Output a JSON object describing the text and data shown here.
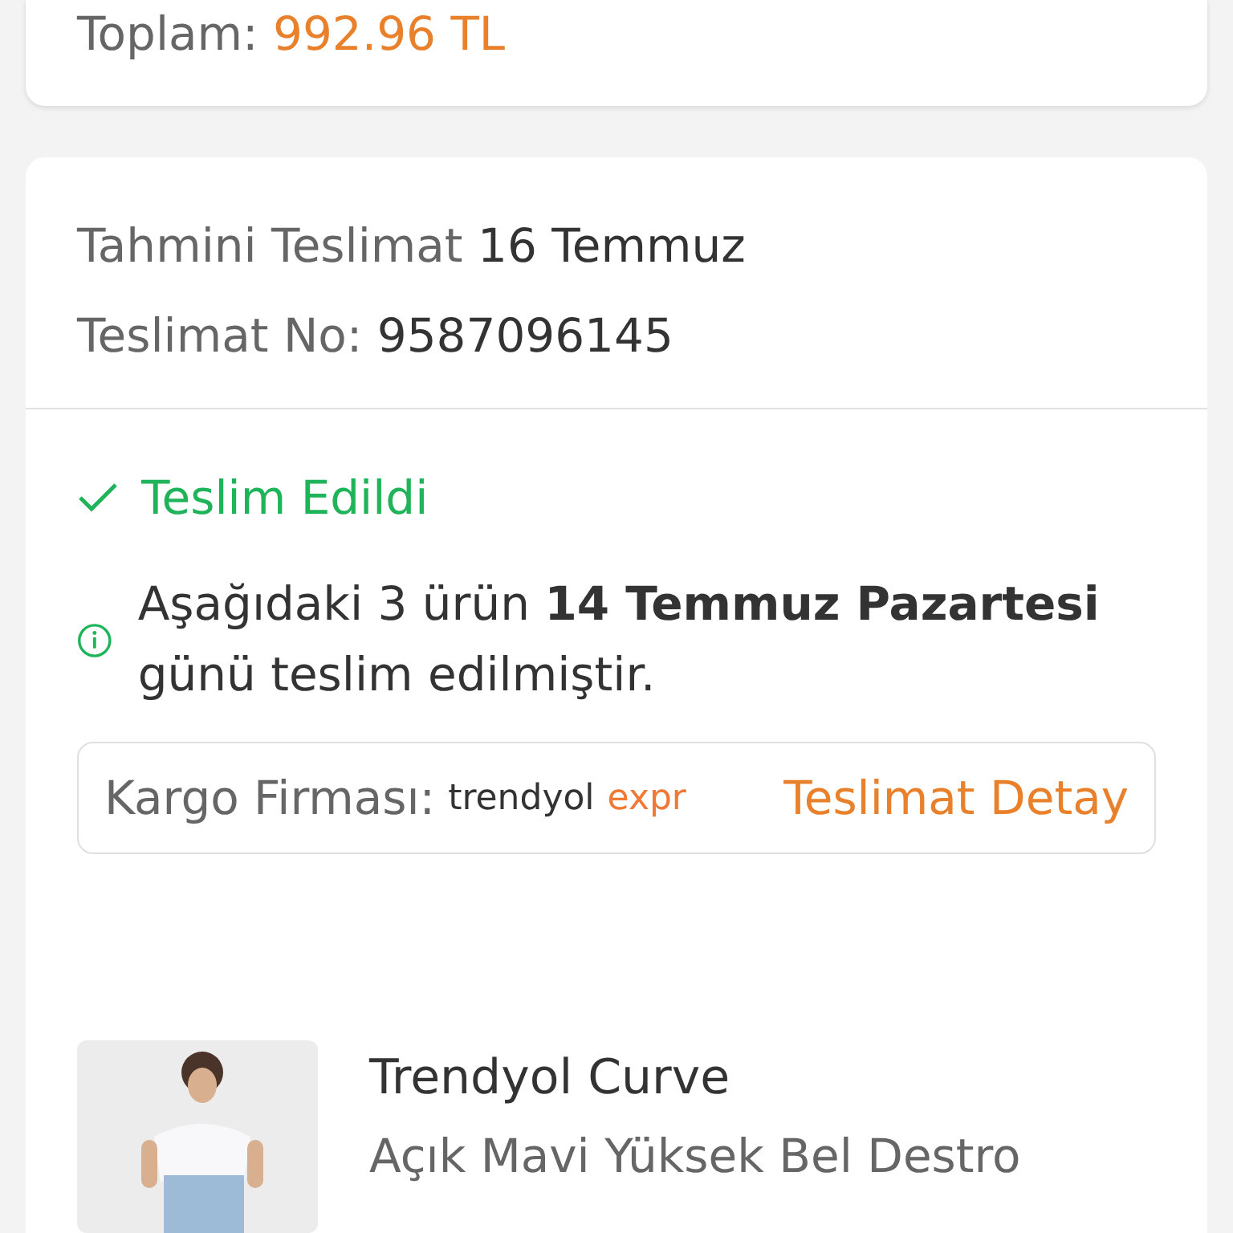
{
  "summary": {
    "total_label": "Toplam:",
    "total_value": "992.96 TL"
  },
  "delivery": {
    "estimate_label": "Tahmini Teslimat",
    "estimate_value": "16 Temmuz",
    "number_label": "Teslimat No:",
    "number_value": "9587096145"
  },
  "status": {
    "kind": "delivered",
    "label": "Teslim Edildi",
    "info": "Aşağıdaki 3 ürün **14 Temmuz Pazartesi** günü teslim edilmiştir."
  },
  "cargo": {
    "label": "Kargo Firması:",
    "logo_part_1": "trendyol",
    "logo_part_2": "expr",
    "detail_link": "Teslimat Detay"
  },
  "products": [
    {
      "brand": "Trendyol Curve",
      "name": "Açık Mavi Yüksek Bel Destro"
    }
  ]
}
